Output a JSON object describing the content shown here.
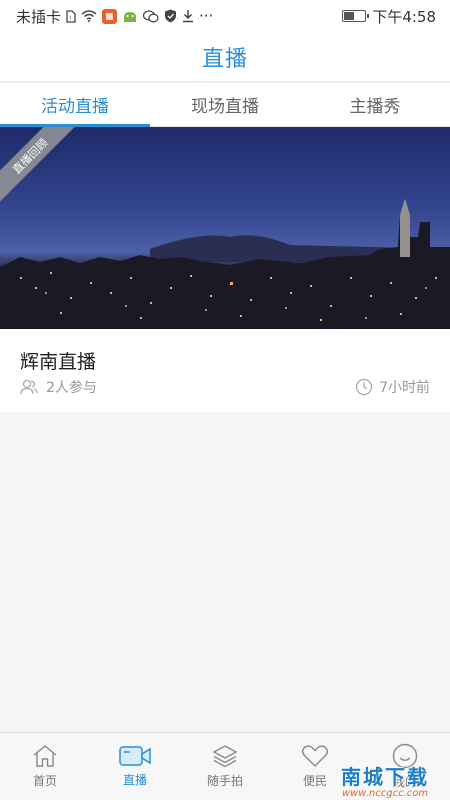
{
  "statusbar": {
    "carrier": "未插卡",
    "time": "下午4:58",
    "more": "···",
    "battery_level": 0.5,
    "icons": [
      "sim-icon",
      "wifi-icon",
      "app-icon",
      "android-icon",
      "wechat-icon",
      "shield-icon",
      "download-icon"
    ]
  },
  "header": {
    "title": "直播"
  },
  "tabs": [
    {
      "label": "活动直播",
      "active": true
    },
    {
      "label": "现场直播",
      "active": false
    },
    {
      "label": "主播秀",
      "active": false
    }
  ],
  "card": {
    "ribbon": "直播回顾",
    "title": "辉南直播",
    "participants": "2人参与",
    "time_ago": "7小时前"
  },
  "bottom_nav": [
    {
      "label": "首页",
      "icon": "home-icon",
      "active": false
    },
    {
      "label": "直播",
      "icon": "video-camera-icon",
      "active": true
    },
    {
      "label": "随手拍",
      "icon": "layers-icon",
      "active": false
    },
    {
      "label": "便民",
      "icon": "heart-icon",
      "active": false
    },
    {
      "label": "我的",
      "icon": "smiley-icon",
      "active": false
    }
  ],
  "watermark": {
    "text": "南城下载",
    "url": "www.nccgcc.com"
  },
  "colors": {
    "accent": "#2b8fd3",
    "muted": "#999999"
  }
}
